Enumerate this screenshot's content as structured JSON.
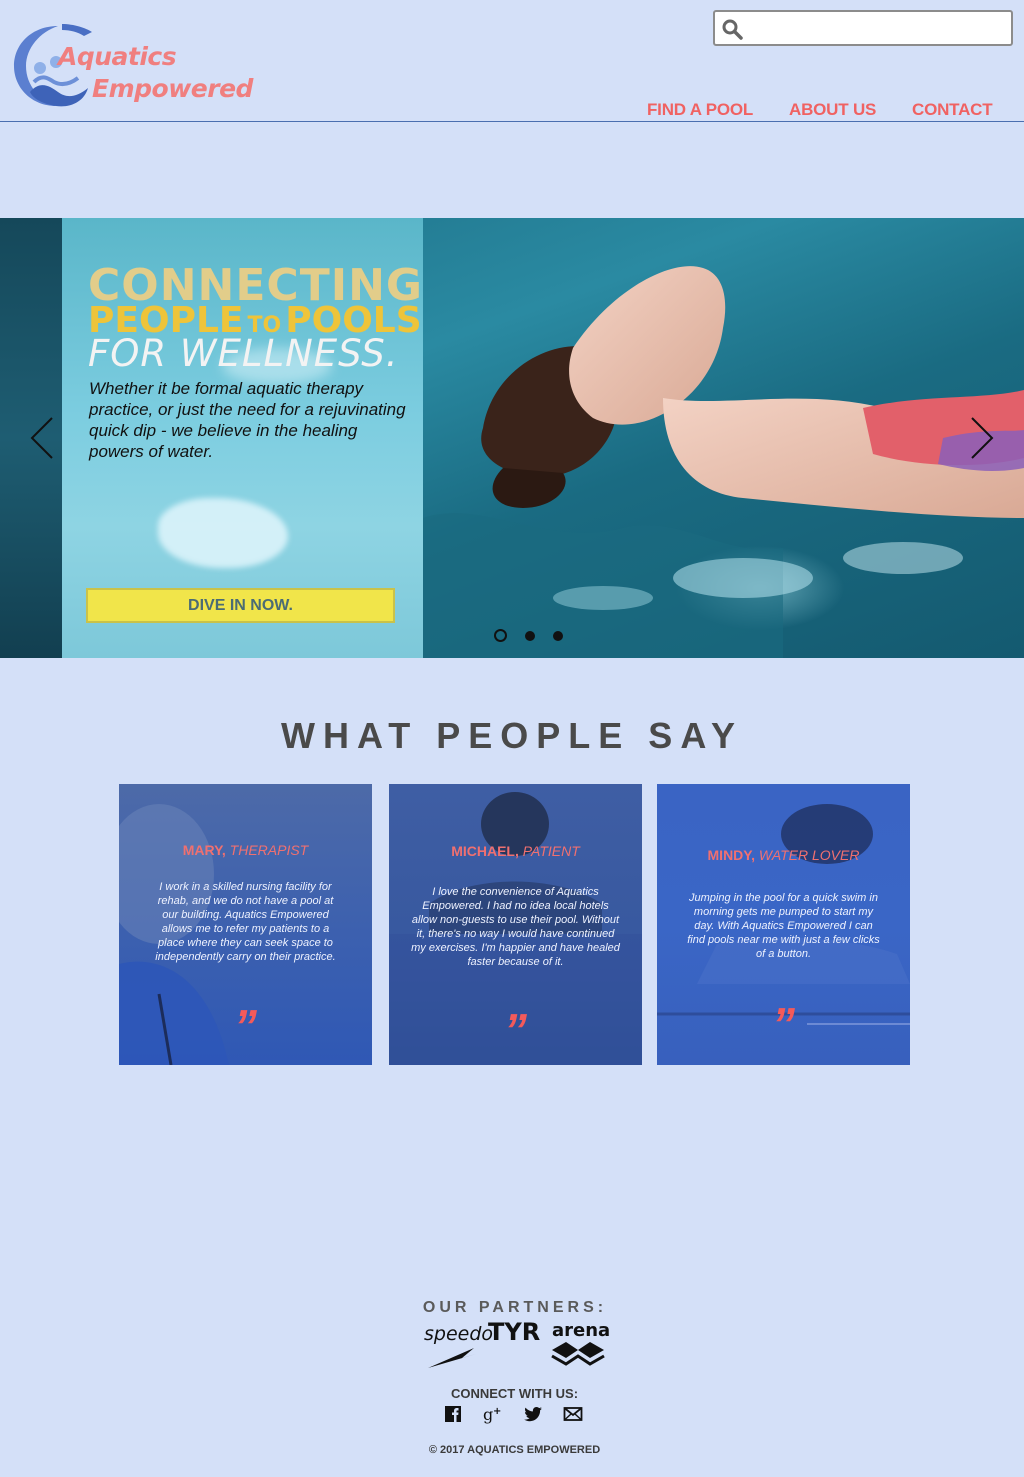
{
  "header": {
    "logo_line1": "Aquatics",
    "logo_line2": "Empowered",
    "search_placeholder": "",
    "nav": [
      "FIND A POOL",
      "ABOUT US",
      "CONTACT"
    ]
  },
  "hero": {
    "line1": "CONNECTING",
    "line2_a": "PEOPLE",
    "line2_to": "TO",
    "line2_b": "POOLS",
    "line3": "FOR WELLNESS.",
    "body": "Whether it be formal aquatic therapy practice, or just the need for a rejuvinating quick dip - we believe in the healing powers of water.",
    "button": "DIVE IN NOW.",
    "slides": 3,
    "active_slide": 1
  },
  "testimonials": {
    "title": "WHAT PEOPLE SAY",
    "items": [
      {
        "name": "MARY,",
        "role": "THERAPIST",
        "quote": "I work in a skilled nursing facility for rehab, and we do not have a pool at our building. Aquatics Empowered allows me to refer my patients to a place where they can seek space to independently carry on their practice."
      },
      {
        "name": "MICHAEL,",
        "role": "PATIENT",
        "quote": "I love the convenience of Aquatics Empowered. I had no idea local hotels allow non-guests to use their pool. Without it, there's no way I would have continued my exercises. I'm happier and have healed faster because of it."
      },
      {
        "name": "MINDY,",
        "role": "WATER LOVER",
        "quote": "Jumping in the pool for a quick swim in morning gets me pumped to start my day. With Aquatics Empowered I can find pools near me with just a few clicks of a button."
      }
    ],
    "quote_mark": "”"
  },
  "footer": {
    "partners_title": "OUR PARTNERS:",
    "partner_logos": [
      "speedo",
      "TYR",
      "arena"
    ],
    "connect_title": "CONNECT WITH US:",
    "social_icons": [
      "facebook-icon",
      "google-plus-icon",
      "twitter-icon",
      "mail-icon"
    ],
    "copyright": "© 2017 AQUATICS EMPOWERED"
  },
  "colors": {
    "background": "#d4e0f8",
    "accent": "#f06262",
    "button": "#f1e54a",
    "hero_gold": "#eec43a"
  }
}
